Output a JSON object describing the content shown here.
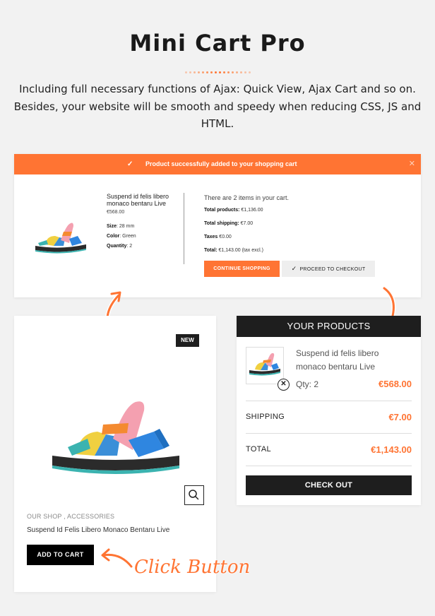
{
  "header": {
    "title": "Mini Cart Pro",
    "intro": "Including full necessary functions of Ajax: Quick View, Ajax Cart and so on. Besides, your website will be smooth and speedy when reducing CSS, JS and HTML."
  },
  "notification": {
    "message": "Product successfully added to your shopping cart",
    "check_icon": "check-icon",
    "close_icon": "close-icon",
    "product": {
      "name": "Suspend id felis libero monaco bentaru Live",
      "price": "€568.00",
      "size_label": "Size",
      "size": "28 mm",
      "color_label": "Color",
      "color": "Green",
      "quantity_label": "Quantity",
      "quantity": "2"
    },
    "summary": {
      "items_text": "There are 2 items in your cart.",
      "total_products_label": "Total products:",
      "total_products": "€1,136.00",
      "total_shipping_label": "Total shipping:",
      "total_shipping": "€7.00",
      "taxes_label": "Taxes",
      "taxes": "€0.00",
      "total_label": "Total:",
      "total": "€1,143.00 (tax excl.)"
    },
    "continue_label": "CONTINUE SHOPPING",
    "checkout_label": "PROCEED TO CHECKOUT"
  },
  "product_card": {
    "badge": "NEW",
    "category": "OUR SHOP , ACCESSORIES",
    "name": "Suspend Id Felis Libero Monaco Bentaru Live",
    "add_to_cart_label": "ADD TO CART",
    "quickview_icon": "search-icon"
  },
  "mini_cart": {
    "heading": "YOUR PRODUCTS",
    "item": {
      "name": "Suspend id felis libero monaco bentaru Live",
      "qty": "Qty: 2",
      "price": "€568.00"
    },
    "shipping_label": "SHIPPING",
    "shipping": "€7.00",
    "total_label": "TOTAL",
    "total": "€1,143.00",
    "checkout_label": "CHECK OUT"
  },
  "annotation": {
    "click_label": "Click Button"
  },
  "colors": {
    "accent": "#ff7433",
    "dark": "#1e1e1e",
    "background": "#f2f2f2",
    "dot_light": "#f7c7ae"
  }
}
